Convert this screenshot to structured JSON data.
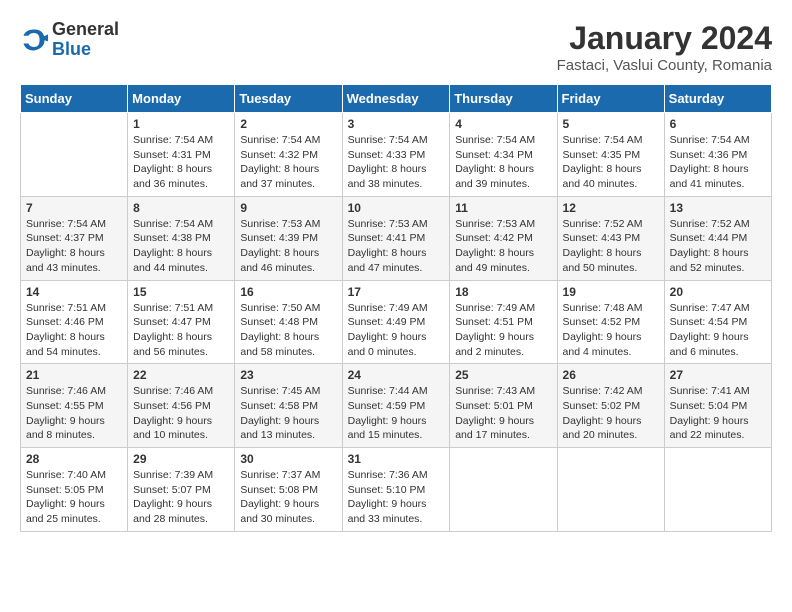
{
  "header": {
    "logo_general": "General",
    "logo_blue": "Blue",
    "title": "January 2024",
    "subtitle": "Fastaci, Vaslui County, Romania"
  },
  "weekdays": [
    "Sunday",
    "Monday",
    "Tuesday",
    "Wednesday",
    "Thursday",
    "Friday",
    "Saturday"
  ],
  "weeks": [
    [
      {
        "day": "",
        "info": ""
      },
      {
        "day": "1",
        "info": "Sunrise: 7:54 AM\nSunset: 4:31 PM\nDaylight: 8 hours\nand 36 minutes."
      },
      {
        "day": "2",
        "info": "Sunrise: 7:54 AM\nSunset: 4:32 PM\nDaylight: 8 hours\nand 37 minutes."
      },
      {
        "day": "3",
        "info": "Sunrise: 7:54 AM\nSunset: 4:33 PM\nDaylight: 8 hours\nand 38 minutes."
      },
      {
        "day": "4",
        "info": "Sunrise: 7:54 AM\nSunset: 4:34 PM\nDaylight: 8 hours\nand 39 minutes."
      },
      {
        "day": "5",
        "info": "Sunrise: 7:54 AM\nSunset: 4:35 PM\nDaylight: 8 hours\nand 40 minutes."
      },
      {
        "day": "6",
        "info": "Sunrise: 7:54 AM\nSunset: 4:36 PM\nDaylight: 8 hours\nand 41 minutes."
      }
    ],
    [
      {
        "day": "7",
        "info": "Sunrise: 7:54 AM\nSunset: 4:37 PM\nDaylight: 8 hours\nand 43 minutes."
      },
      {
        "day": "8",
        "info": "Sunrise: 7:54 AM\nSunset: 4:38 PM\nDaylight: 8 hours\nand 44 minutes."
      },
      {
        "day": "9",
        "info": "Sunrise: 7:53 AM\nSunset: 4:39 PM\nDaylight: 8 hours\nand 46 minutes."
      },
      {
        "day": "10",
        "info": "Sunrise: 7:53 AM\nSunset: 4:41 PM\nDaylight: 8 hours\nand 47 minutes."
      },
      {
        "day": "11",
        "info": "Sunrise: 7:53 AM\nSunset: 4:42 PM\nDaylight: 8 hours\nand 49 minutes."
      },
      {
        "day": "12",
        "info": "Sunrise: 7:52 AM\nSunset: 4:43 PM\nDaylight: 8 hours\nand 50 minutes."
      },
      {
        "day": "13",
        "info": "Sunrise: 7:52 AM\nSunset: 4:44 PM\nDaylight: 8 hours\nand 52 minutes."
      }
    ],
    [
      {
        "day": "14",
        "info": "Sunrise: 7:51 AM\nSunset: 4:46 PM\nDaylight: 8 hours\nand 54 minutes."
      },
      {
        "day": "15",
        "info": "Sunrise: 7:51 AM\nSunset: 4:47 PM\nDaylight: 8 hours\nand 56 minutes."
      },
      {
        "day": "16",
        "info": "Sunrise: 7:50 AM\nSunset: 4:48 PM\nDaylight: 8 hours\nand 58 minutes."
      },
      {
        "day": "17",
        "info": "Sunrise: 7:49 AM\nSunset: 4:49 PM\nDaylight: 9 hours\nand 0 minutes."
      },
      {
        "day": "18",
        "info": "Sunrise: 7:49 AM\nSunset: 4:51 PM\nDaylight: 9 hours\nand 2 minutes."
      },
      {
        "day": "19",
        "info": "Sunrise: 7:48 AM\nSunset: 4:52 PM\nDaylight: 9 hours\nand 4 minutes."
      },
      {
        "day": "20",
        "info": "Sunrise: 7:47 AM\nSunset: 4:54 PM\nDaylight: 9 hours\nand 6 minutes."
      }
    ],
    [
      {
        "day": "21",
        "info": "Sunrise: 7:46 AM\nSunset: 4:55 PM\nDaylight: 9 hours\nand 8 minutes."
      },
      {
        "day": "22",
        "info": "Sunrise: 7:46 AM\nSunset: 4:56 PM\nDaylight: 9 hours\nand 10 minutes."
      },
      {
        "day": "23",
        "info": "Sunrise: 7:45 AM\nSunset: 4:58 PM\nDaylight: 9 hours\nand 13 minutes."
      },
      {
        "day": "24",
        "info": "Sunrise: 7:44 AM\nSunset: 4:59 PM\nDaylight: 9 hours\nand 15 minutes."
      },
      {
        "day": "25",
        "info": "Sunrise: 7:43 AM\nSunset: 5:01 PM\nDaylight: 9 hours\nand 17 minutes."
      },
      {
        "day": "26",
        "info": "Sunrise: 7:42 AM\nSunset: 5:02 PM\nDaylight: 9 hours\nand 20 minutes."
      },
      {
        "day": "27",
        "info": "Sunrise: 7:41 AM\nSunset: 5:04 PM\nDaylight: 9 hours\nand 22 minutes."
      }
    ],
    [
      {
        "day": "28",
        "info": "Sunrise: 7:40 AM\nSunset: 5:05 PM\nDaylight: 9 hours\nand 25 minutes."
      },
      {
        "day": "29",
        "info": "Sunrise: 7:39 AM\nSunset: 5:07 PM\nDaylight: 9 hours\nand 28 minutes."
      },
      {
        "day": "30",
        "info": "Sunrise: 7:37 AM\nSunset: 5:08 PM\nDaylight: 9 hours\nand 30 minutes."
      },
      {
        "day": "31",
        "info": "Sunrise: 7:36 AM\nSunset: 5:10 PM\nDaylight: 9 hours\nand 33 minutes."
      },
      {
        "day": "",
        "info": ""
      },
      {
        "day": "",
        "info": ""
      },
      {
        "day": "",
        "info": ""
      }
    ]
  ]
}
